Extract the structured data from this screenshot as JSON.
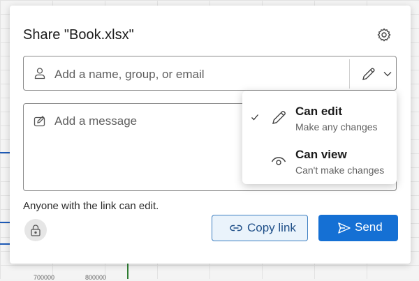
{
  "dialog": {
    "title": "Share \"Book.xlsx\"",
    "recipients_placeholder": "Add a name, group, or email",
    "message_placeholder": "Add a message",
    "link_status": "Anyone with the link can edit.",
    "copy_link_label": "Copy link",
    "send_label": "Send"
  },
  "permission_menu": {
    "items": [
      {
        "title": "Can edit",
        "subtitle": "Make any changes",
        "selected": true,
        "icon": "pencil-icon"
      },
      {
        "title": "Can view",
        "subtitle": "Can't make changes",
        "selected": false,
        "icon": "eye-icon"
      }
    ]
  },
  "background": {
    "bottom_labels": [
      "700000",
      "800000"
    ]
  },
  "colors": {
    "accent": "#1570d4",
    "copy_button_bg": "#eaf3fb",
    "copy_button_border": "#3d7fc1"
  },
  "icons": [
    "gear-icon",
    "person-icon",
    "pencil-icon",
    "chevron-down-icon",
    "compose-icon",
    "checkmark-icon",
    "eye-icon",
    "lock-icon",
    "link-icon",
    "send-icon"
  ]
}
